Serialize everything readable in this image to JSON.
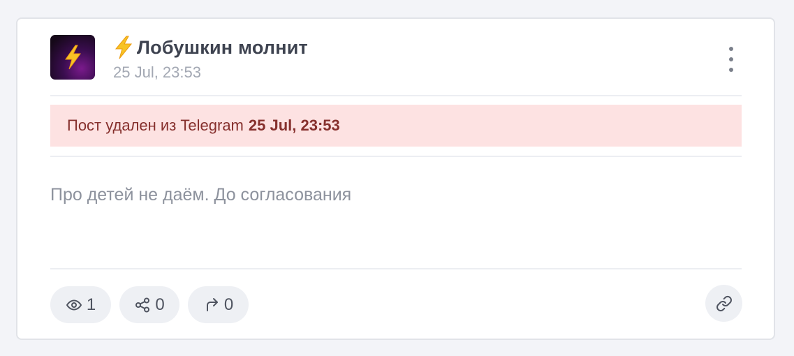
{
  "post": {
    "author_name": "Лобушкин молнит",
    "author_emoji_icon": "high-voltage-icon",
    "date": "25 Jul, 23:53",
    "deleted_notice": {
      "text": "Пост удален из Telegram",
      "timestamp": "25 Jul, 23:53"
    },
    "body": "Про детей не даём. До согласования"
  },
  "stats": {
    "views": {
      "icon": "eye-icon",
      "count": "1"
    },
    "shares": {
      "icon": "share-icon",
      "count": "0"
    },
    "forwards": {
      "icon": "forward-icon",
      "count": "0"
    }
  },
  "actions": {
    "more_icon": "kebab-menu-icon",
    "link_icon": "link-icon"
  },
  "colors": {
    "alert_bg": "#fde2e2",
    "alert_text": "#86302d",
    "author_text": "#3e4350",
    "muted_text": "#a3a8b3",
    "chip_bg": "#eef0f4"
  }
}
